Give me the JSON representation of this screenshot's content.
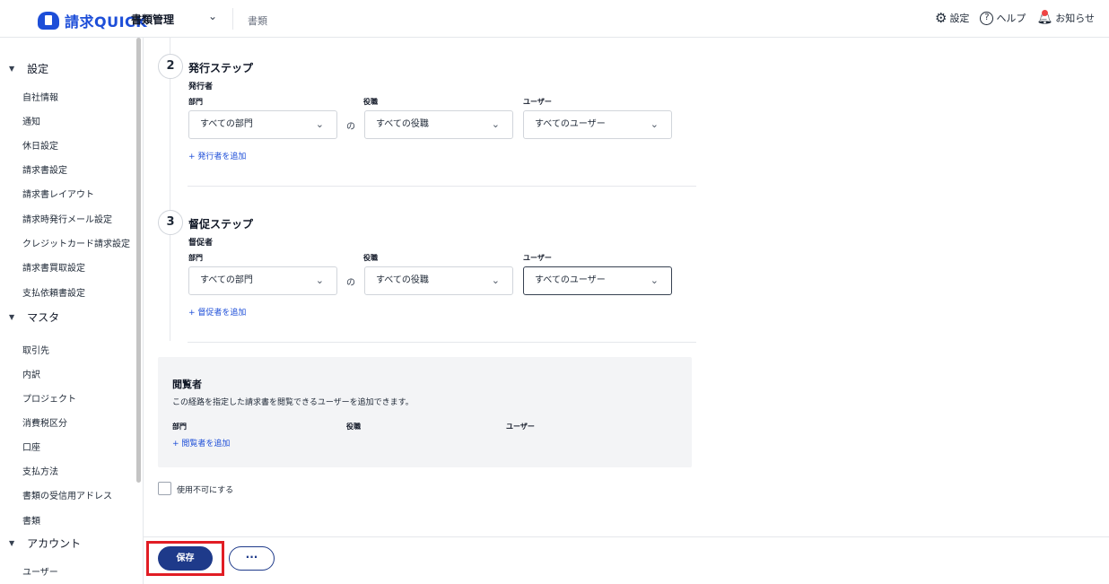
{
  "header": {
    "app_name": "請求QUICK",
    "nav_current": "書類管理",
    "nav_link": "書類",
    "settings_label": "設定",
    "help_label": "ヘルプ",
    "notice_label": "お知らせ"
  },
  "sidebar": {
    "groups": [
      {
        "label": "設定"
      },
      {
        "label": "マスタ"
      },
      {
        "label": "アカウント"
      }
    ],
    "settings_items": [
      "自社情報",
      "通知",
      "休日設定",
      "請求書設定",
      "請求書レイアウト",
      "請求時発行メール設定",
      "クレジットカード請求設定",
      "請求書買取設定",
      "支払依頼書設定"
    ],
    "master_items": [
      "取引先",
      "内訳",
      "プロジェクト",
      "消費税区分",
      "口座",
      "支払方法",
      "書類の受信用アドレス",
      "書類"
    ],
    "account_items": [
      "ユーザー"
    ]
  },
  "issue_step": {
    "number": "2",
    "title": "発行ステップ",
    "sub": "発行者",
    "col_dept": "部門",
    "col_role": "役職",
    "col_user": "ユーザー",
    "dept_value": "すべての部門",
    "no": "の",
    "role_value": "すべての役職",
    "user_value": "すべてのユーザー",
    "add_link": "+ 発行者を追加"
  },
  "dunning_step": {
    "number": "3",
    "title": "督促ステップ",
    "sub": "督促者",
    "col_dept": "部門",
    "col_role": "役職",
    "col_user": "ユーザー",
    "dept_value": "すべての部門",
    "no": "の",
    "role_value": "すべての役職",
    "user_value": "すべてのユーザー",
    "add_link": "+ 督促者を追加"
  },
  "viewer": {
    "title": "閲覧者",
    "desc": "この経路を指定した請求書を閲覧できるユーザーを追加できます。",
    "col_dept": "部門",
    "col_role": "役職",
    "col_user": "ユーザー",
    "add_link": "+ 閲覧者を追加"
  },
  "disable_label": "使用不可にする",
  "footer": {
    "save_label": "保存",
    "more_label": "···"
  }
}
